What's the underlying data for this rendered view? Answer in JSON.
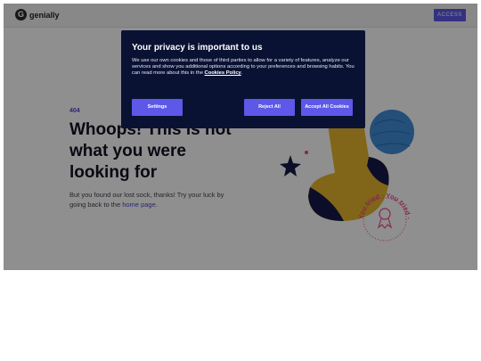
{
  "header": {
    "logo_mark": "G",
    "logo_text": "genially",
    "access_label": "ACCESS"
  },
  "main": {
    "code": "404",
    "headline": "Whoops! This is not what you were looking for",
    "body_prefix": "But you found our lost sock, thanks! Try your luck by going back to the ",
    "home_link": "home page",
    "body_suffix": "."
  },
  "illustration": {
    "badge_text": "You tried · You tried · "
  },
  "cookie_dialog": {
    "title": "Your privacy is important to us",
    "text": "We use our own cookies and those of third parties to allow for a variety of features, analyze our services and show you additional options according to your preferences and browsing habits. You can read more about this in the ",
    "policy_link": "Cookies Policy",
    "text_end": ".",
    "settings_label": "Settings",
    "reject_label": "Reject All",
    "accept_label": "Accept All Cookies"
  },
  "colors": {
    "accent": "#5d58e8",
    "dialog_bg": "#0a1233",
    "sock_yellow": "#e7b72d",
    "sock_navy": "#16194a",
    "ball_blue": "#3f8ed8",
    "badge_pink": "#e9468a"
  }
}
